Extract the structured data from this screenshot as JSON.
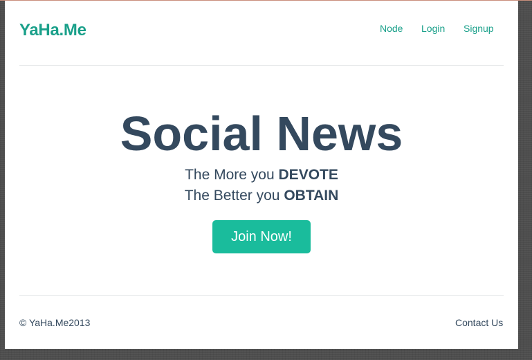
{
  "header": {
    "brand": "YaHa.Me",
    "nav": [
      "Node",
      "Login",
      "Signup"
    ]
  },
  "hero": {
    "title": "Social News",
    "line1_prefix": "The More you ",
    "line1_emphasis": "DEVOTE",
    "line2_prefix": "The Better you ",
    "line2_emphasis": "OBTAIN",
    "cta_label": "Join Now!"
  },
  "footer": {
    "copyright": "© YaHa.Me2013",
    "contact": "Contact Us"
  },
  "colors": {
    "brand": "#1aa08a",
    "text_dark": "#34495e",
    "cta_bg": "#1abc9c"
  }
}
